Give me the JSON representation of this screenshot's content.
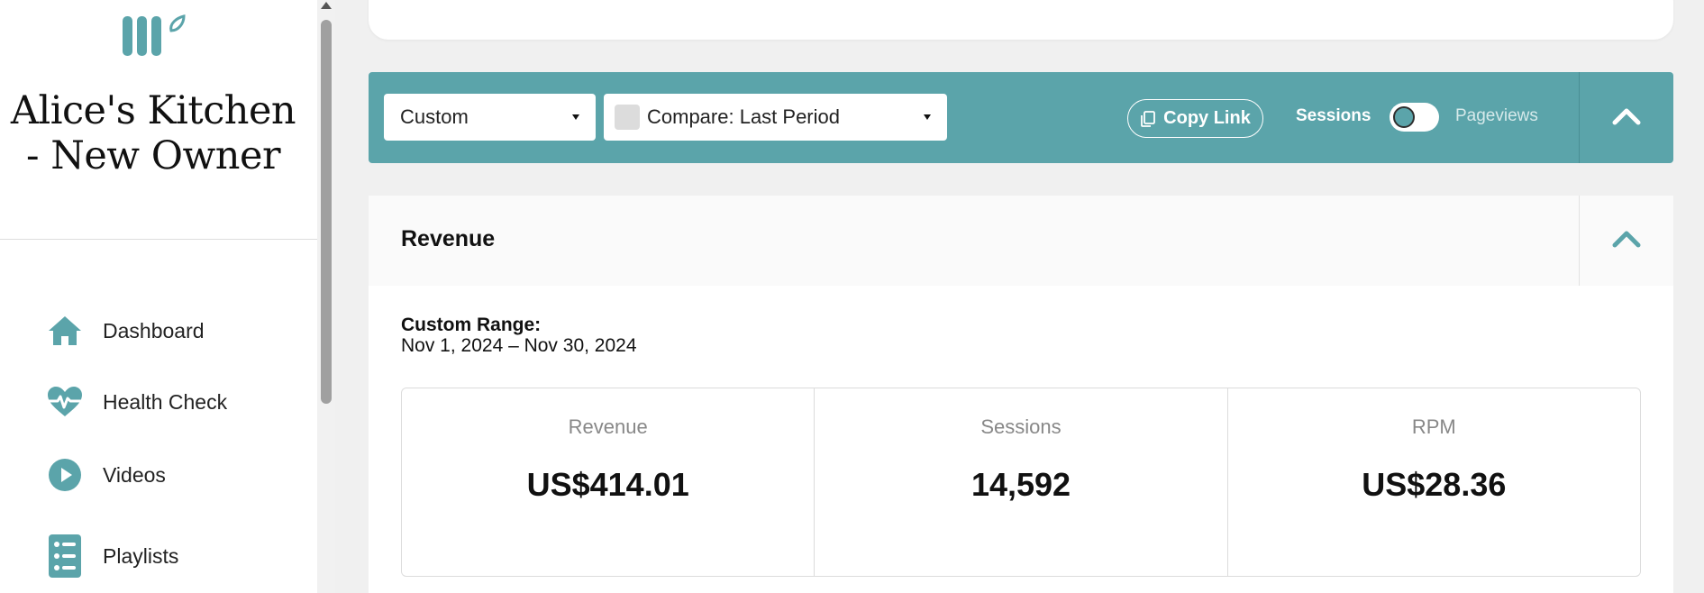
{
  "sidebar": {
    "site_title": "Alice's Kitchen - New Owner",
    "items": [
      {
        "label": "Dashboard",
        "icon": "home-icon"
      },
      {
        "label": "Health Check",
        "icon": "heartbeat-icon"
      },
      {
        "label": "Videos",
        "icon": "play-circle-icon"
      },
      {
        "label": "Playlists",
        "icon": "list-icon"
      }
    ]
  },
  "filter_bar": {
    "period_select": "Custom",
    "compare_select": "Compare: Last Period",
    "copy_link_label": "Copy Link",
    "toggle_left_label": "Sessions",
    "toggle_right_label": "Pageviews"
  },
  "revenue_panel": {
    "title": "Revenue",
    "range_heading": "Custom Range:",
    "range_dates": "Nov 1, 2024 – Nov 30, 2024",
    "stats": [
      {
        "label": "Revenue",
        "value": "US$414.01"
      },
      {
        "label": "Sessions",
        "value": "14,592"
      },
      {
        "label": "RPM",
        "value": "US$28.36"
      }
    ]
  },
  "colors": {
    "accent": "#5ba4aa",
    "sidebar_bg": "#ffffff",
    "page_bg": "#f0f0f0"
  }
}
